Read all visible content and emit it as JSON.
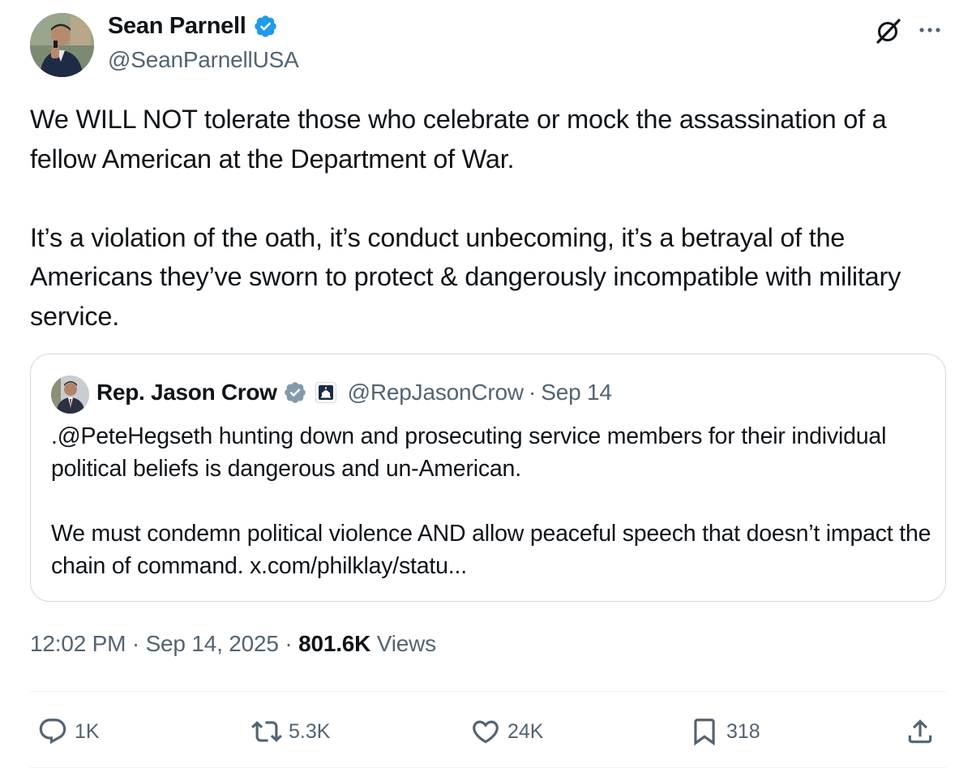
{
  "author": {
    "display_name": "Sean Parnell",
    "handle": "@SeanParnellUSA",
    "verified": true
  },
  "tweet": {
    "text": "We WILL NOT tolerate those who celebrate or mock the assassination of a fellow American at the Department of War.\n\nIt’s a violation of the oath, it’s conduct unbecoming, it’s a betrayal of the Americans they’ve sworn to protect & dangerously incompatible with military service."
  },
  "quote": {
    "display_name": "Rep. Jason Crow",
    "handle": "@RepJasonCrow",
    "separator": "·",
    "date": "Sep 14",
    "text": ".@PeteHegseth hunting down and prosecuting service members for their individual political beliefs is dangerous and un-American.\n\nWe must condemn political violence AND allow peaceful speech that doesn’t impact the chain of command. x.com/philklay/statu..."
  },
  "meta": {
    "time": "12:02 PM",
    "separator": "·",
    "date": "Sep 14, 2025",
    "views_count": "801.6K",
    "views_label": "Views"
  },
  "actions": {
    "replies": "1K",
    "reposts": "5.3K",
    "likes": "24K",
    "bookmarks": "318"
  },
  "icons": {
    "verified": "verified-badge-icon",
    "grok": "grok-icon",
    "more": "more-icon",
    "reply": "reply-icon",
    "repost": "repost-icon",
    "like": "heart-icon",
    "bookmark": "bookmark-icon",
    "share": "share-icon",
    "affiliation": "capitol-icon"
  },
  "colors": {
    "verified_blue": "#1d9bf0",
    "verified_gray": "#829aab",
    "text_primary": "#0f1419",
    "text_secondary": "#536471",
    "border": "#cfd9de"
  }
}
